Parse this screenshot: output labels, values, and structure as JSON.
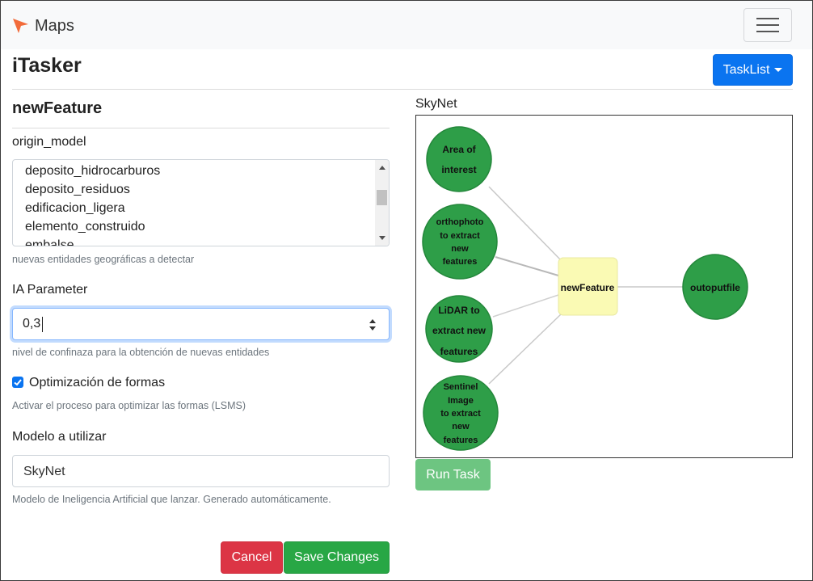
{
  "navbar": {
    "brand": "Maps",
    "brand_color": "#f26b3a"
  },
  "header": {
    "app_title": "iTasker",
    "tasklist_label": "TaskList",
    "primary_color": "#0a74f0"
  },
  "form": {
    "title": "newFeature",
    "origin_model": {
      "label": "origin_model",
      "options": [
        "deposito_hidrocarburos",
        "deposito_residuos",
        "edificacion_ligera",
        "elemento_construido",
        "embalse"
      ],
      "help": "nuevas entidades geográficas a detectar"
    },
    "ia_parameter": {
      "label": "IA Parameter",
      "value": "0,3",
      "help": "nivel de confinaza para la obtención de nuevas entidades"
    },
    "optimization": {
      "label": "Optimización de formas",
      "checked": true,
      "help": "Activar el proceso para optimizar las formas (LSMS)"
    },
    "model": {
      "label": "Modelo a utilizar",
      "value": "SkyNet",
      "help": "Modelo de Ineligencia Artificial que lanzar. Generado automáticamente."
    },
    "cancel_label": "Cancel",
    "save_label": "Save Changes"
  },
  "diagram": {
    "label": "SkyNet",
    "nodes": {
      "area": [
        "Area of",
        "interest"
      ],
      "ortho": [
        "orthophoto",
        "to extract",
        "new",
        "features"
      ],
      "lidar": [
        "LiDAR to",
        "extract new",
        "features"
      ],
      "sentinel": [
        "Sentinel",
        "Image",
        "to extract",
        "new",
        "features"
      ],
      "center": [
        "newFeature"
      ],
      "output": [
        "outoputfile"
      ]
    },
    "colors": {
      "circle": "#2e9e48",
      "circle_stroke": "#24873b",
      "center": "#fafab4",
      "edge": "#c8c8c8"
    },
    "run_label": "Run Task"
  }
}
